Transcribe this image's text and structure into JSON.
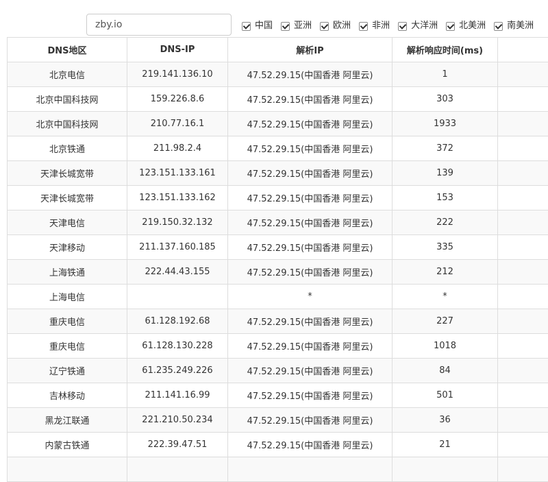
{
  "search": {
    "value": "zby.io"
  },
  "filters": [
    {
      "label": "中国",
      "checked": true
    },
    {
      "label": "亚洲",
      "checked": true
    },
    {
      "label": "欧洲",
      "checked": true
    },
    {
      "label": "非洲",
      "checked": true
    },
    {
      "label": "大洋洲",
      "checked": true
    },
    {
      "label": "北美洲",
      "checked": true
    },
    {
      "label": "南美洲",
      "checked": true
    }
  ],
  "table": {
    "headers": [
      "DNS地区",
      "DNS-IP",
      "解析IP",
      "解析响应时间(ms)",
      ""
    ],
    "rows": [
      [
        "北京电信",
        "219.141.136.10",
        "47.52.29.15(中国香港 阿里云)",
        "1",
        ""
      ],
      [
        "北京中国科技网",
        "159.226.8.6",
        "47.52.29.15(中国香港 阿里云)",
        "303",
        ""
      ],
      [
        "北京中国科技网",
        "210.77.16.1",
        "47.52.29.15(中国香港 阿里云)",
        "1933",
        ""
      ],
      [
        "北京铁通",
        "211.98.2.4",
        "47.52.29.15(中国香港 阿里云)",
        "372",
        ""
      ],
      [
        "天津长城宽带",
        "123.151.133.161",
        "47.52.29.15(中国香港 阿里云)",
        "139",
        ""
      ],
      [
        "天津长城宽带",
        "123.151.133.162",
        "47.52.29.15(中国香港 阿里云)",
        "153",
        ""
      ],
      [
        "天津电信",
        "219.150.32.132",
        "47.52.29.15(中国香港 阿里云)",
        "222",
        ""
      ],
      [
        "天津移动",
        "211.137.160.185",
        "47.52.29.15(中国香港 阿里云)",
        "335",
        ""
      ],
      [
        "上海铁通",
        "222.44.43.155",
        "47.52.29.15(中国香港 阿里云)",
        "212",
        ""
      ],
      [
        "上海电信",
        "",
        "*",
        "*",
        ""
      ],
      [
        "重庆电信",
        "61.128.192.68",
        "47.52.29.15(中国香港 阿里云)",
        "227",
        ""
      ],
      [
        "重庆电信",
        "61.128.130.228",
        "47.52.29.15(中国香港 阿里云)",
        "1018",
        ""
      ],
      [
        "辽宁铁通",
        "61.235.249.226",
        "47.52.29.15(中国香港 阿里云)",
        "84",
        ""
      ],
      [
        "吉林移动",
        "211.141.16.99",
        "47.52.29.15(中国香港 阿里云)",
        "501",
        ""
      ],
      [
        "黑龙江联通",
        "221.210.50.234",
        "47.52.29.15(中国香港 阿里云)",
        "36",
        ""
      ],
      [
        "内蒙古铁通",
        "222.39.47.51",
        "47.52.29.15(中国香港 阿里云)",
        "21",
        ""
      ],
      [
        "",
        "",
        "",
        "",
        ""
      ]
    ]
  }
}
